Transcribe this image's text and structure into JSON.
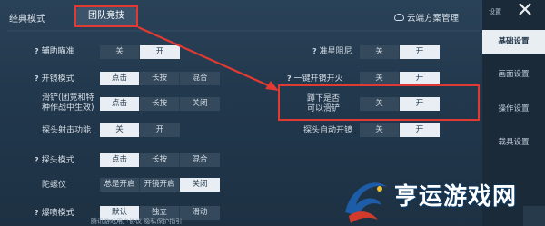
{
  "header": {
    "tab_classic": "经典模式",
    "tab_team": "团队竞技",
    "cloud_label": "云端方案管理"
  },
  "sidebar": {
    "settings_label": "设置",
    "items": [
      {
        "label": "基础设置",
        "active": true
      },
      {
        "label": "画面设置",
        "active": false
      },
      {
        "label": "操作设置",
        "active": false
      },
      {
        "label": "载具设置",
        "active": false
      }
    ]
  },
  "left_rows": [
    {
      "label": "辅助瞄准",
      "help": "?",
      "options": [
        "关",
        "开"
      ],
      "selected": 1
    },
    {
      "label": "开镜模式",
      "help": "?",
      "options": [
        "点击",
        "长按",
        "混合"
      ],
      "selected": 0
    },
    {
      "label": "滑铲(团竞和特\n种作战中生效)",
      "help": "",
      "options": [
        "点击",
        "长按",
        "关闭"
      ],
      "selected": 0
    },
    {
      "label": "探头射击功能",
      "help": "",
      "options": [
        "关",
        "开"
      ],
      "selected": 0
    },
    {
      "label": "探头模式",
      "help": "?",
      "options": [
        "点击",
        "长按",
        "混合"
      ],
      "selected": 0
    },
    {
      "label": "陀螺仪",
      "help": "",
      "options": [
        "总是开启",
        "开镜开启",
        "关闭"
      ],
      "selected": 2
    },
    {
      "label": "爆喷模式",
      "help": "?",
      "options": [
        "默认",
        "独立",
        "滑动"
      ],
      "selected": 0
    }
  ],
  "right_rows": [
    {
      "label": "准星阻尼",
      "help": "?",
      "options": [
        "关",
        "开"
      ],
      "selected": 1
    },
    {
      "label": "一键开镜开火",
      "help": "?",
      "options": [
        "关",
        "开"
      ],
      "selected": 1
    },
    {
      "label": "蹲下是否\n可以滑铲",
      "help": "",
      "options": [
        "关",
        "开"
      ],
      "selected": 1
    },
    {
      "label": "探头自动开镜",
      "help": "",
      "options": [
        "关",
        "开"
      ],
      "selected": 1
    }
  ],
  "bottom": {
    "text": "腾讯游戏用户协议    隐私保护指引"
  },
  "watermark": {
    "text": "亨运游戏网"
  },
  "colors": {
    "annotation": "#e03a33",
    "active_option": "#e8eef3",
    "panel_bg": "#22384d"
  }
}
